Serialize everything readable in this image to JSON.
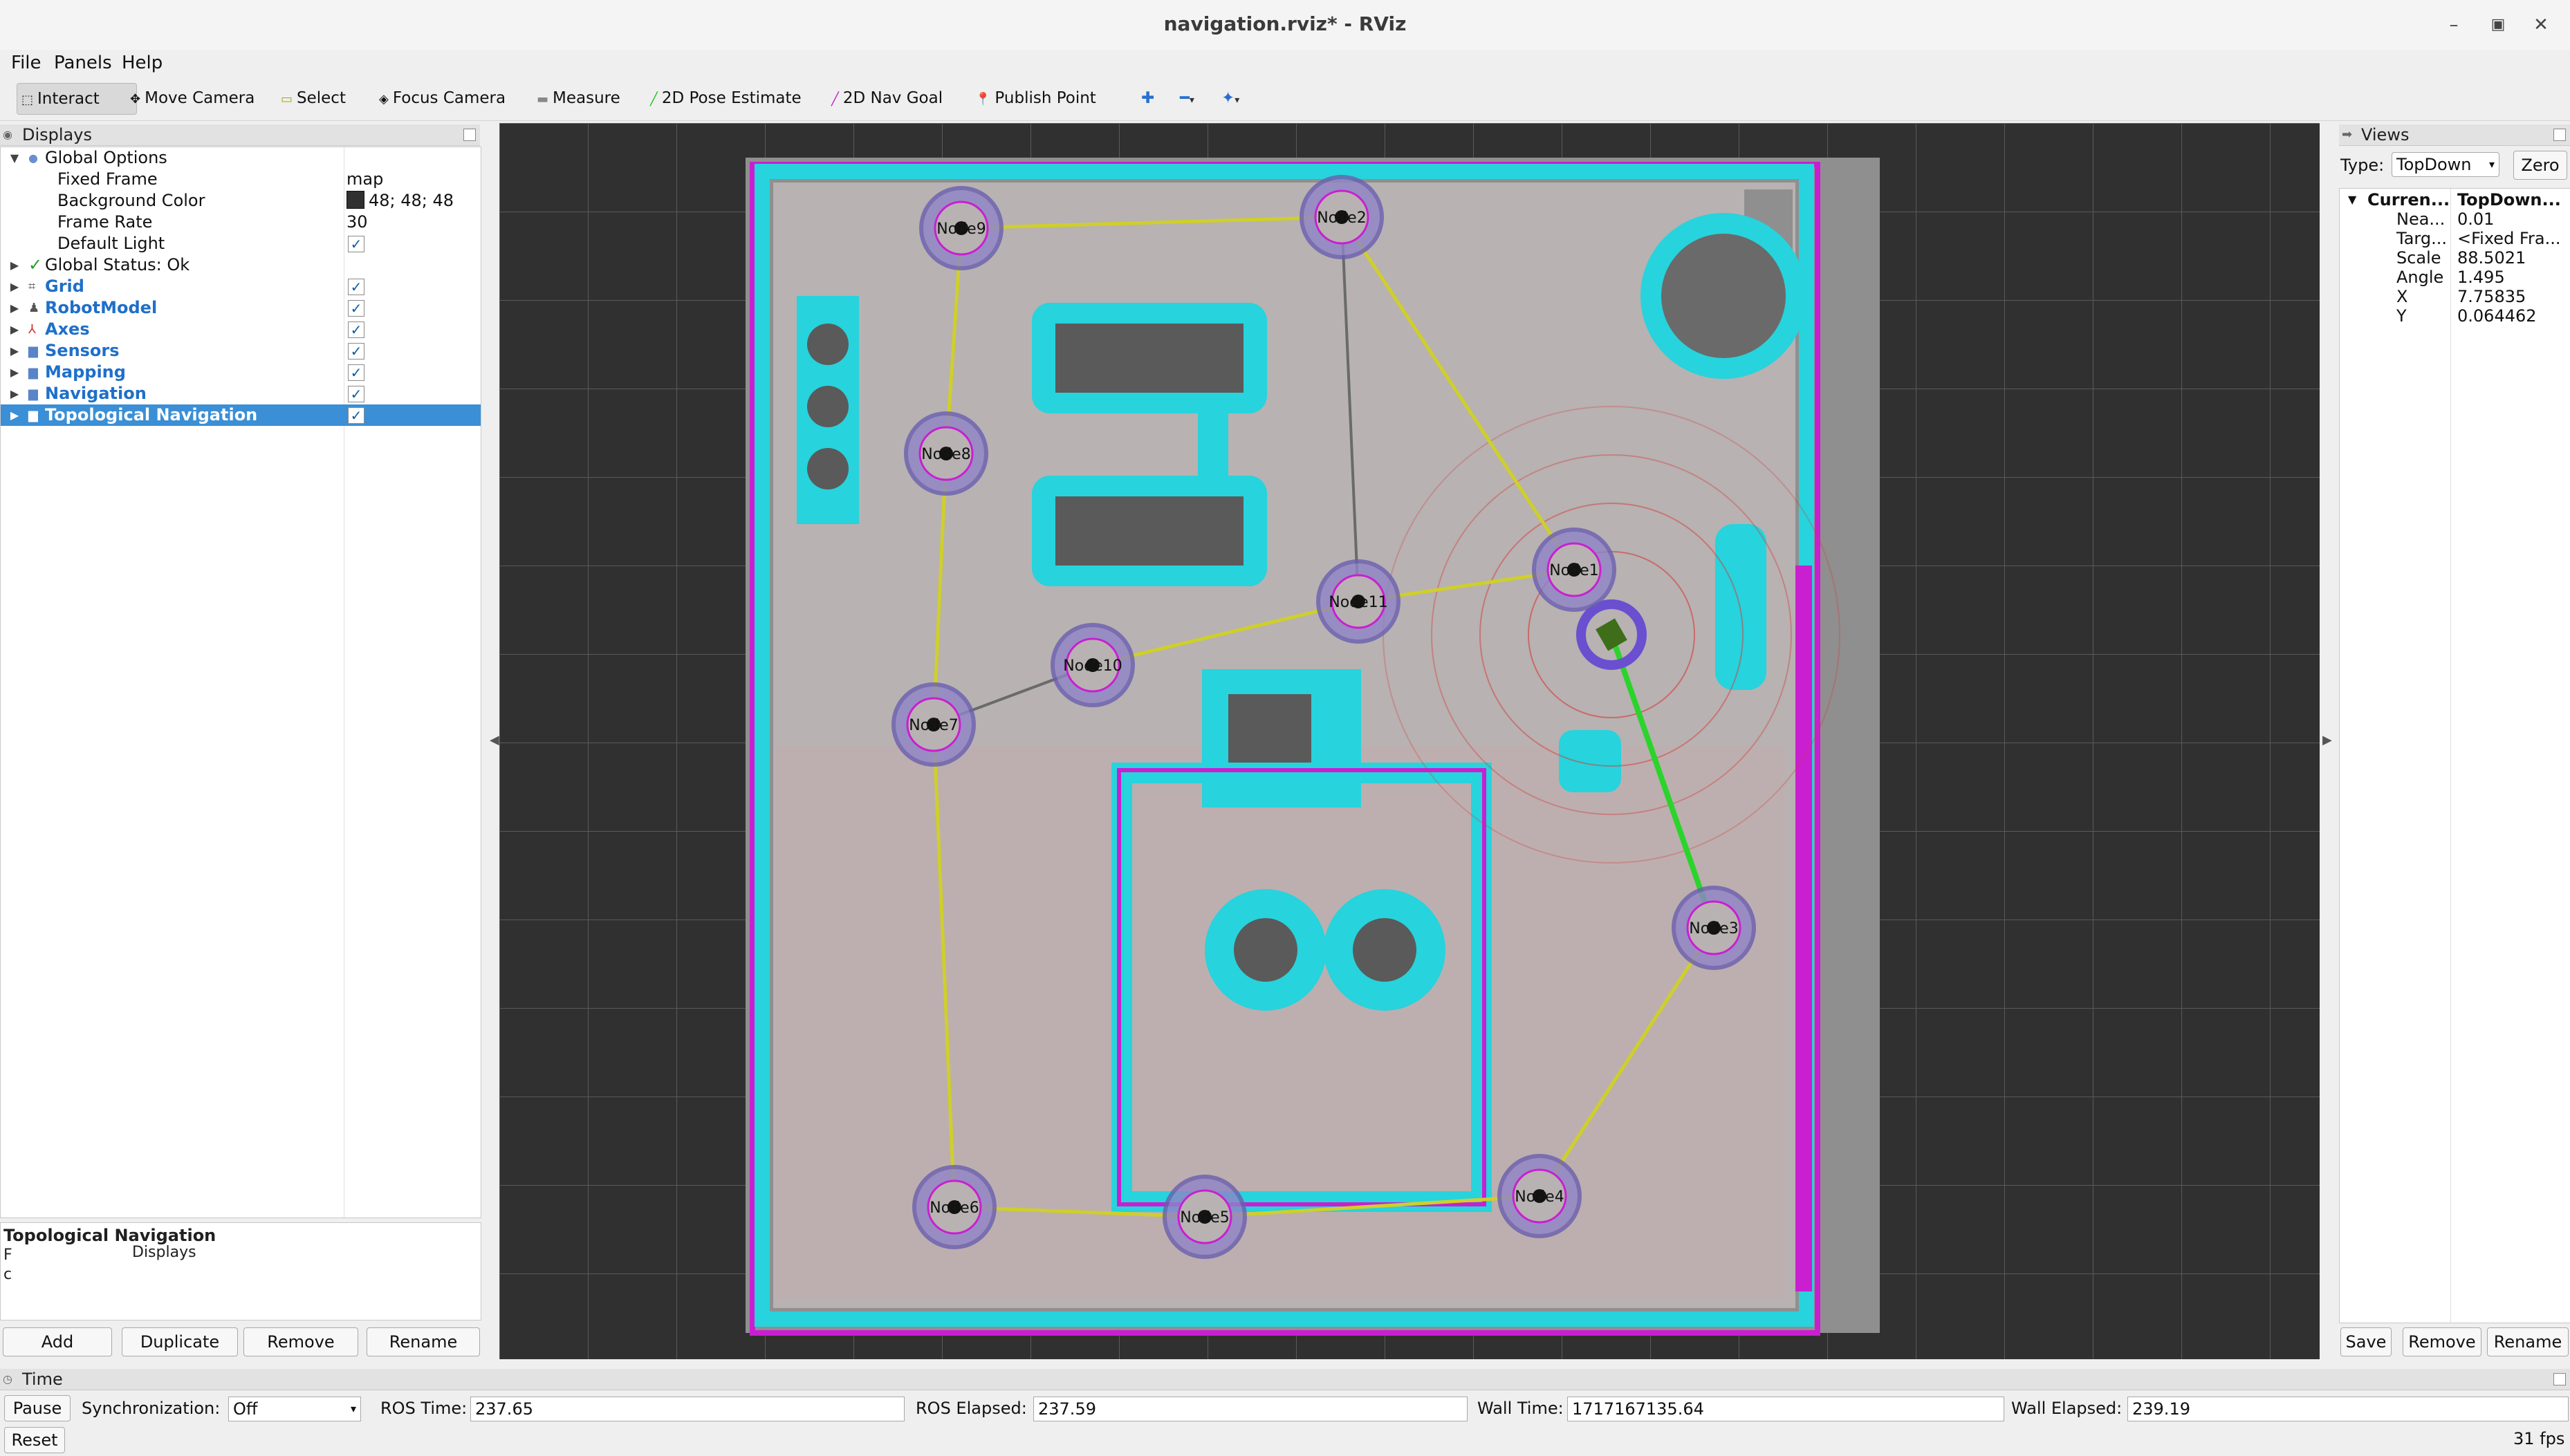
{
  "window": {
    "title": "navigation.rviz* - RViz"
  },
  "menu": [
    "File",
    "Panels",
    "Help"
  ],
  "toolbar": {
    "tools": [
      "Interact",
      "Move Camera",
      "Select",
      "Focus Camera",
      "Measure",
      "2D Pose Estimate",
      "2D Nav Goal",
      "Publish Point"
    ]
  },
  "displays": {
    "header": "Displays",
    "global_options": "Global Options",
    "fixed_frame_label": "Fixed Frame",
    "fixed_frame_value": "map",
    "bg_color_label": "Background Color",
    "bg_color_value": "48; 48; 48",
    "frame_rate_label": "Frame Rate",
    "frame_rate_value": "30",
    "default_light_label": "Default Light",
    "global_status": "Global Status: Ok",
    "items": [
      "Grid",
      "RobotModel",
      "Axes",
      "Sensors",
      "Mapping",
      "Navigation",
      "Topological Navigation"
    ],
    "check": "✓",
    "description_title": "Topological Navigation",
    "description_text": "Displays",
    "description_line1": "F",
    "description_line2": "c",
    "buttons": [
      "Add",
      "Duplicate",
      "Remove",
      "Rename"
    ]
  },
  "views": {
    "header": "Views",
    "type_label": "Type:",
    "type_value": "TopDown",
    "zero": "Zero",
    "current_label": "Curren...",
    "current_value": "TopDown...",
    "props": [
      {
        "k": "Nea...",
        "v": "0.01"
      },
      {
        "k": "Targ...",
        "v": "<Fixed Fra..."
      },
      {
        "k": "Scale",
        "v": "88.5021"
      },
      {
        "k": "Angle",
        "v": "1.495"
      },
      {
        "k": "X",
        "v": "7.75835"
      },
      {
        "k": "Y",
        "v": "0.064462"
      }
    ],
    "buttons": [
      "Save",
      "Remove",
      "Rename"
    ]
  },
  "time": {
    "header": "Time",
    "pause": "Pause",
    "sync_label": "Synchronization:",
    "sync_value": "Off",
    "ros_time_label": "ROS Time:",
    "ros_time": "237.65",
    "ros_elapsed_label": "ROS Elapsed:",
    "ros_elapsed": "237.59",
    "wall_time_label": "Wall Time:",
    "wall_time": "1717167135.64",
    "wall_elapsed_label": "Wall Elapsed:",
    "wall_elapsed": "239.19",
    "reset": "Reset",
    "fps": "31 fps"
  },
  "map": {
    "nodes": [
      "Node9",
      "Node2",
      "Node8",
      "Node11",
      "Node1",
      "Node10",
      "Node7",
      "Node3",
      "Node6",
      "Node5",
      "Node4"
    ]
  },
  "colors": {
    "bg": "#303030",
    "cyan": "#27d3dc",
    "magenta": "#c91fd0",
    "floor": "#b8b2b2",
    "selection": "#3a8fd6"
  }
}
